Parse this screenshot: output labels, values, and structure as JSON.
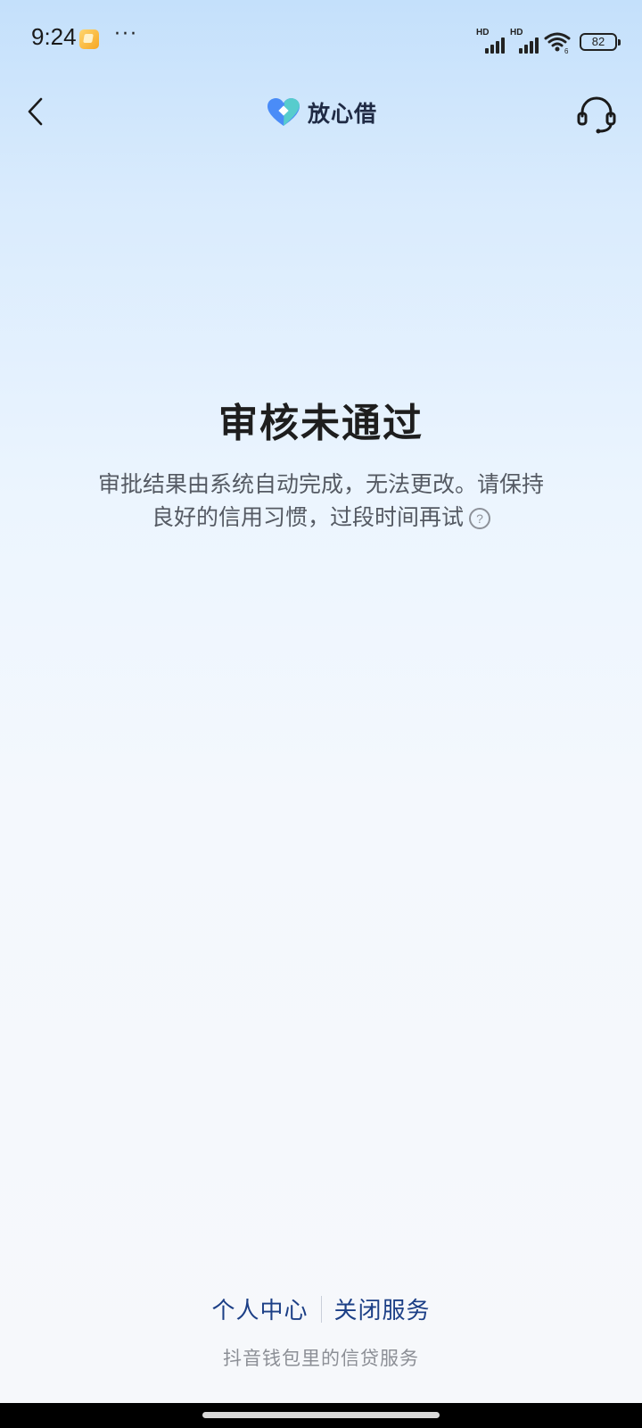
{
  "status_bar": {
    "time": "9:24",
    "more": "···",
    "sim1_label": "HD",
    "sim2_label": "HD",
    "wifi_label": "6",
    "battery_level": "82",
    "notification_icon": "app-notification-icon"
  },
  "nav": {
    "back_icon": "chevron-left-icon",
    "brand_name": "放心借",
    "service_icon": "headset-icon",
    "colors": {
      "logo_primary": "#4a8cf7",
      "logo_secondary": "#59d3c8"
    }
  },
  "result": {
    "title": "审核未通过",
    "description": "审批结果由系统自动完成，无法更改。请保持良好的信用习惯，过段时间再试",
    "help_icon_text": "?"
  },
  "footer": {
    "personal_center": "个人中心",
    "close_service": "关闭服务",
    "note": "抖音钱包里的信贷服务",
    "link_color": "#1c3f86"
  }
}
